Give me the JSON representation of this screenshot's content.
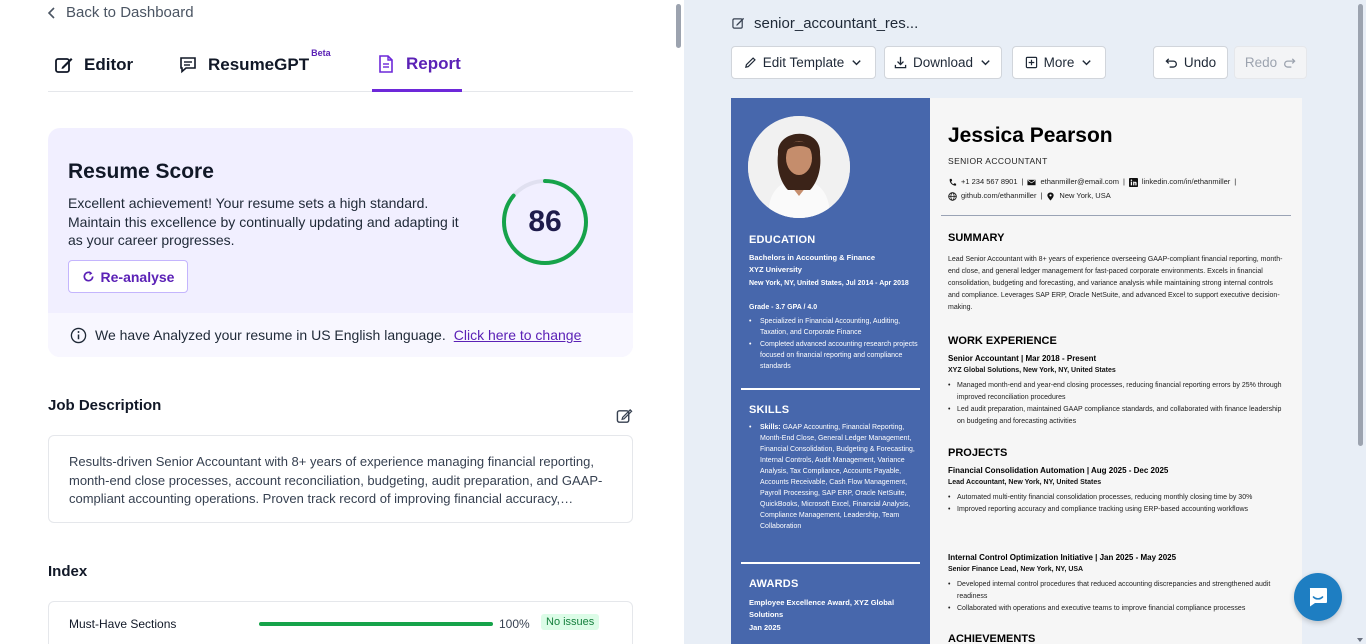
{
  "nav": {
    "back_label": "Back to Dashboard"
  },
  "tabs": [
    {
      "label": "Editor",
      "icon": "edit-icon"
    },
    {
      "label": "ResumeGPT",
      "badge": "Beta",
      "icon": "chat-icon"
    },
    {
      "label": "Report",
      "icon": "document-icon",
      "active": true
    }
  ],
  "score": {
    "title": "Resume Score",
    "description": "Excellent achievement! Your resume sets a high standard. Maintain this excellence by continually updating and adapting it as your career progresses.",
    "value": "86",
    "fraction": 0.86,
    "reanalyse_label": "Re-analyse",
    "language_note": "We have Analyzed your resume in US English language.",
    "change_link": "Click here to change",
    "colors": {
      "accent": "#6d28d9",
      "gauge": "#16a34a",
      "gauge_track": "#e0e0f0"
    }
  },
  "job_description": {
    "title": "Job Description",
    "text": "Results-driven Senior Accountant with 8+ years of experience managing financial reporting, month-end close processes, account reconciliation, budgeting, audit preparation, and GAAP-compliant accounting operations. Proven track record of improving financial accuracy, reducing closing time and strengthening internal controls."
  },
  "index": {
    "title": "Index",
    "rows": [
      {
        "label": "Must-Have Sections",
        "percent": "100%",
        "fraction": 1.0,
        "status": "No issues"
      }
    ]
  },
  "document": {
    "filename": "senior_accountant_res...",
    "toolbar": {
      "edit_template": "Edit Template",
      "download": "Download",
      "more": "More",
      "undo": "Undo",
      "redo": "Redo"
    }
  },
  "resume": {
    "name": "Jessica Pearson",
    "role": "SENIOR ACCOUNTANT",
    "contact_line1": {
      "phone": "+1 234 567 8901",
      "email": "ethanmiller@email.com",
      "linkedin": "linkedin.com/in/ethanmiller"
    },
    "contact_line2": {
      "github": "github.com/ethanmiller",
      "location": "New York, USA"
    },
    "sidebar": {
      "education": {
        "heading": "EDUCATION",
        "degree": "Bachelors in Accounting & Finance",
        "school": "XYZ University",
        "meta": "New York, NY, United States, Jul 2014 - Apr 2018",
        "grade": "Grade - 3.7 GPA / 4.0",
        "bullets": [
          "Specialized in Financial Accounting, Auditing, Taxation, and Corporate Finance",
          "Completed advanced accounting research projects focused on financial reporting and compliance standards"
        ]
      },
      "skills": {
        "heading": "SKILLS",
        "label": "Skills:",
        "text": "GAAP Accounting, Financial Reporting, Month-End Close, General Ledger Management, Financial Consolidation, Budgeting & Forecasting, Internal Controls, Audit Management, Variance Analysis, Tax Compliance, Accounts Payable, Accounts Receivable, Cash Flow Management, Payroll Processing, SAP ERP, Oracle NetSuite, QuickBooks, Microsoft Excel, Financial Analysis, Compliance Management, Leadership, Team Collaboration"
      },
      "awards": {
        "heading": "AWARDS",
        "title": "Employee Excellence Award, XYZ Global Solutions",
        "date": "Jan 2025"
      }
    },
    "summary": {
      "heading": "SUMMARY",
      "text": "Lead Senior Accountant with 8+ years of experience overseeing GAAP-compliant financial reporting, month-end close, and general ledger management for fast-paced corporate environments. Excels in financial consolidation, budgeting and forecasting, and variance analysis while maintaining strong internal controls and compliance. Leverages SAP ERP, Oracle NetSuite, and advanced Excel to support executive decision-making."
    },
    "experience": {
      "heading": "WORK EXPERIENCE",
      "title": "Senior Accountant | Mar 2018 - Present",
      "company": "XYZ Global Solutions, New York, NY, United States",
      "bullets": [
        "Managed month-end and year-end closing processes, reducing financial reporting errors by 25% through improved reconciliation procedures",
        "Led audit preparation, maintained GAAP compliance standards, and collaborated with finance leadership on budgeting and forecasting activities"
      ]
    },
    "projects": {
      "heading": "PROJECTS",
      "items": [
        {
          "title": "Financial Consolidation Automation | Aug 2025 - Dec 2025",
          "sub": "Lead Accountant, New York, NY, United States",
          "bullets": [
            "Automated multi-entity financial consolidation processes, reducing monthly closing time by 30%",
            "Improved reporting accuracy and compliance tracking using ERP-based accounting workflows"
          ]
        },
        {
          "title": "Internal Control Optimization Initiative | Jan 2025 - May 2025",
          "sub": "Senior Finance Lead, New York, NY, USA",
          "bullets": [
            "Developed internal control procedures that reduced accounting discrepancies and strengthened audit readiness",
            "Collaborated with operations and executive teams to improve financial compliance processes"
          ]
        }
      ]
    },
    "achievements": {
      "heading": "ACHIEVEMENTS"
    },
    "colors": {
      "sidebar": "#4767ac"
    }
  }
}
